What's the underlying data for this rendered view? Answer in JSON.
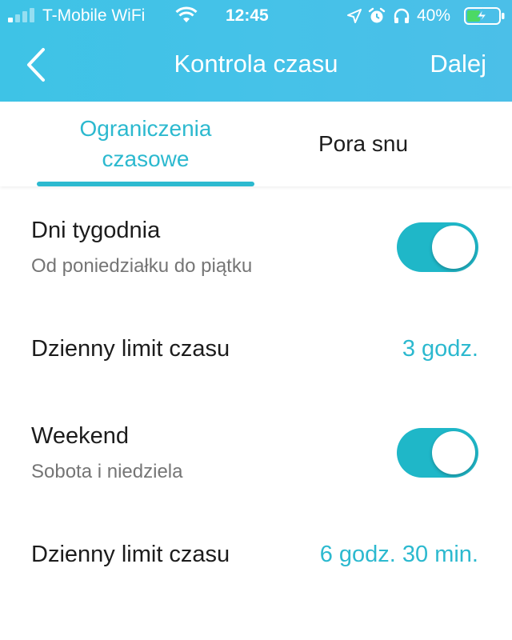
{
  "status_bar": {
    "carrier": "T-Mobile WiFi",
    "time": "12:45",
    "battery_percent": "40%",
    "signal_bars_filled": 1,
    "signal_bars_total": 4,
    "battery_level": 0.4
  },
  "nav": {
    "title": "Kontrola czasu",
    "next_label": "Dalej",
    "back_icon": "chevron-left-icon"
  },
  "tabs": [
    {
      "label_line1": "Ograniczenia",
      "label_line2": "czasowe",
      "active": true
    },
    {
      "label": "Pora snu",
      "active": false
    }
  ],
  "settings": {
    "weekdays": {
      "title": "Dni tygodnia",
      "subtitle": "Od poniedziałku do piątku",
      "enabled": true
    },
    "weekday_limit": {
      "label": "Dzienny limit czasu",
      "value": "3 godz."
    },
    "weekend": {
      "title": "Weekend",
      "subtitle": "Sobota i niedziela",
      "enabled": true
    },
    "weekend_limit": {
      "label": "Dzienny limit czasu",
      "value": "6 godz. 30 min."
    }
  },
  "colors": {
    "header": "#45c2e8",
    "accent": "#2cb9cf",
    "toggle_on": "#1fb7c8"
  }
}
